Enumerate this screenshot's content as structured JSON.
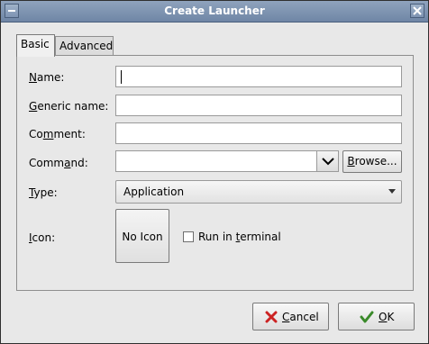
{
  "window": {
    "title": "Create Launcher"
  },
  "tabs": [
    {
      "label": "Basic",
      "active": true
    },
    {
      "label": "Advanced",
      "active": false
    }
  ],
  "form": {
    "name": {
      "label_mn": "N",
      "label_rest": "ame:",
      "value": ""
    },
    "generic_name": {
      "label_mn": "G",
      "label_rest": "eneric name:",
      "value": ""
    },
    "comment": {
      "label_pre": "Co",
      "label_mn": "m",
      "label_rest": "ment:",
      "value": ""
    },
    "command": {
      "label_pre": "Comm",
      "label_mn": "a",
      "label_rest": "nd:",
      "value": "",
      "browse_pre": "",
      "browse_mn": "B",
      "browse_rest": "rowse..."
    },
    "type": {
      "label_mn": "T",
      "label_rest": "ype:",
      "selected": "Application"
    },
    "icon": {
      "label_mn": "I",
      "label_rest": "con:",
      "button_label": "No Icon"
    },
    "run_in_terminal": {
      "label_pre": "Run in ",
      "label_mn": "t",
      "label_rest": "erminal",
      "checked": false
    }
  },
  "buttons": {
    "cancel": {
      "mn": "C",
      "rest": "ancel"
    },
    "ok": {
      "mn": "O",
      "rest": "K"
    }
  },
  "colors": {
    "titlebar": "#7b91af",
    "background": "#e8e8e8",
    "cancel_icon": "#cc2222",
    "ok_icon": "#3a8a2a"
  }
}
